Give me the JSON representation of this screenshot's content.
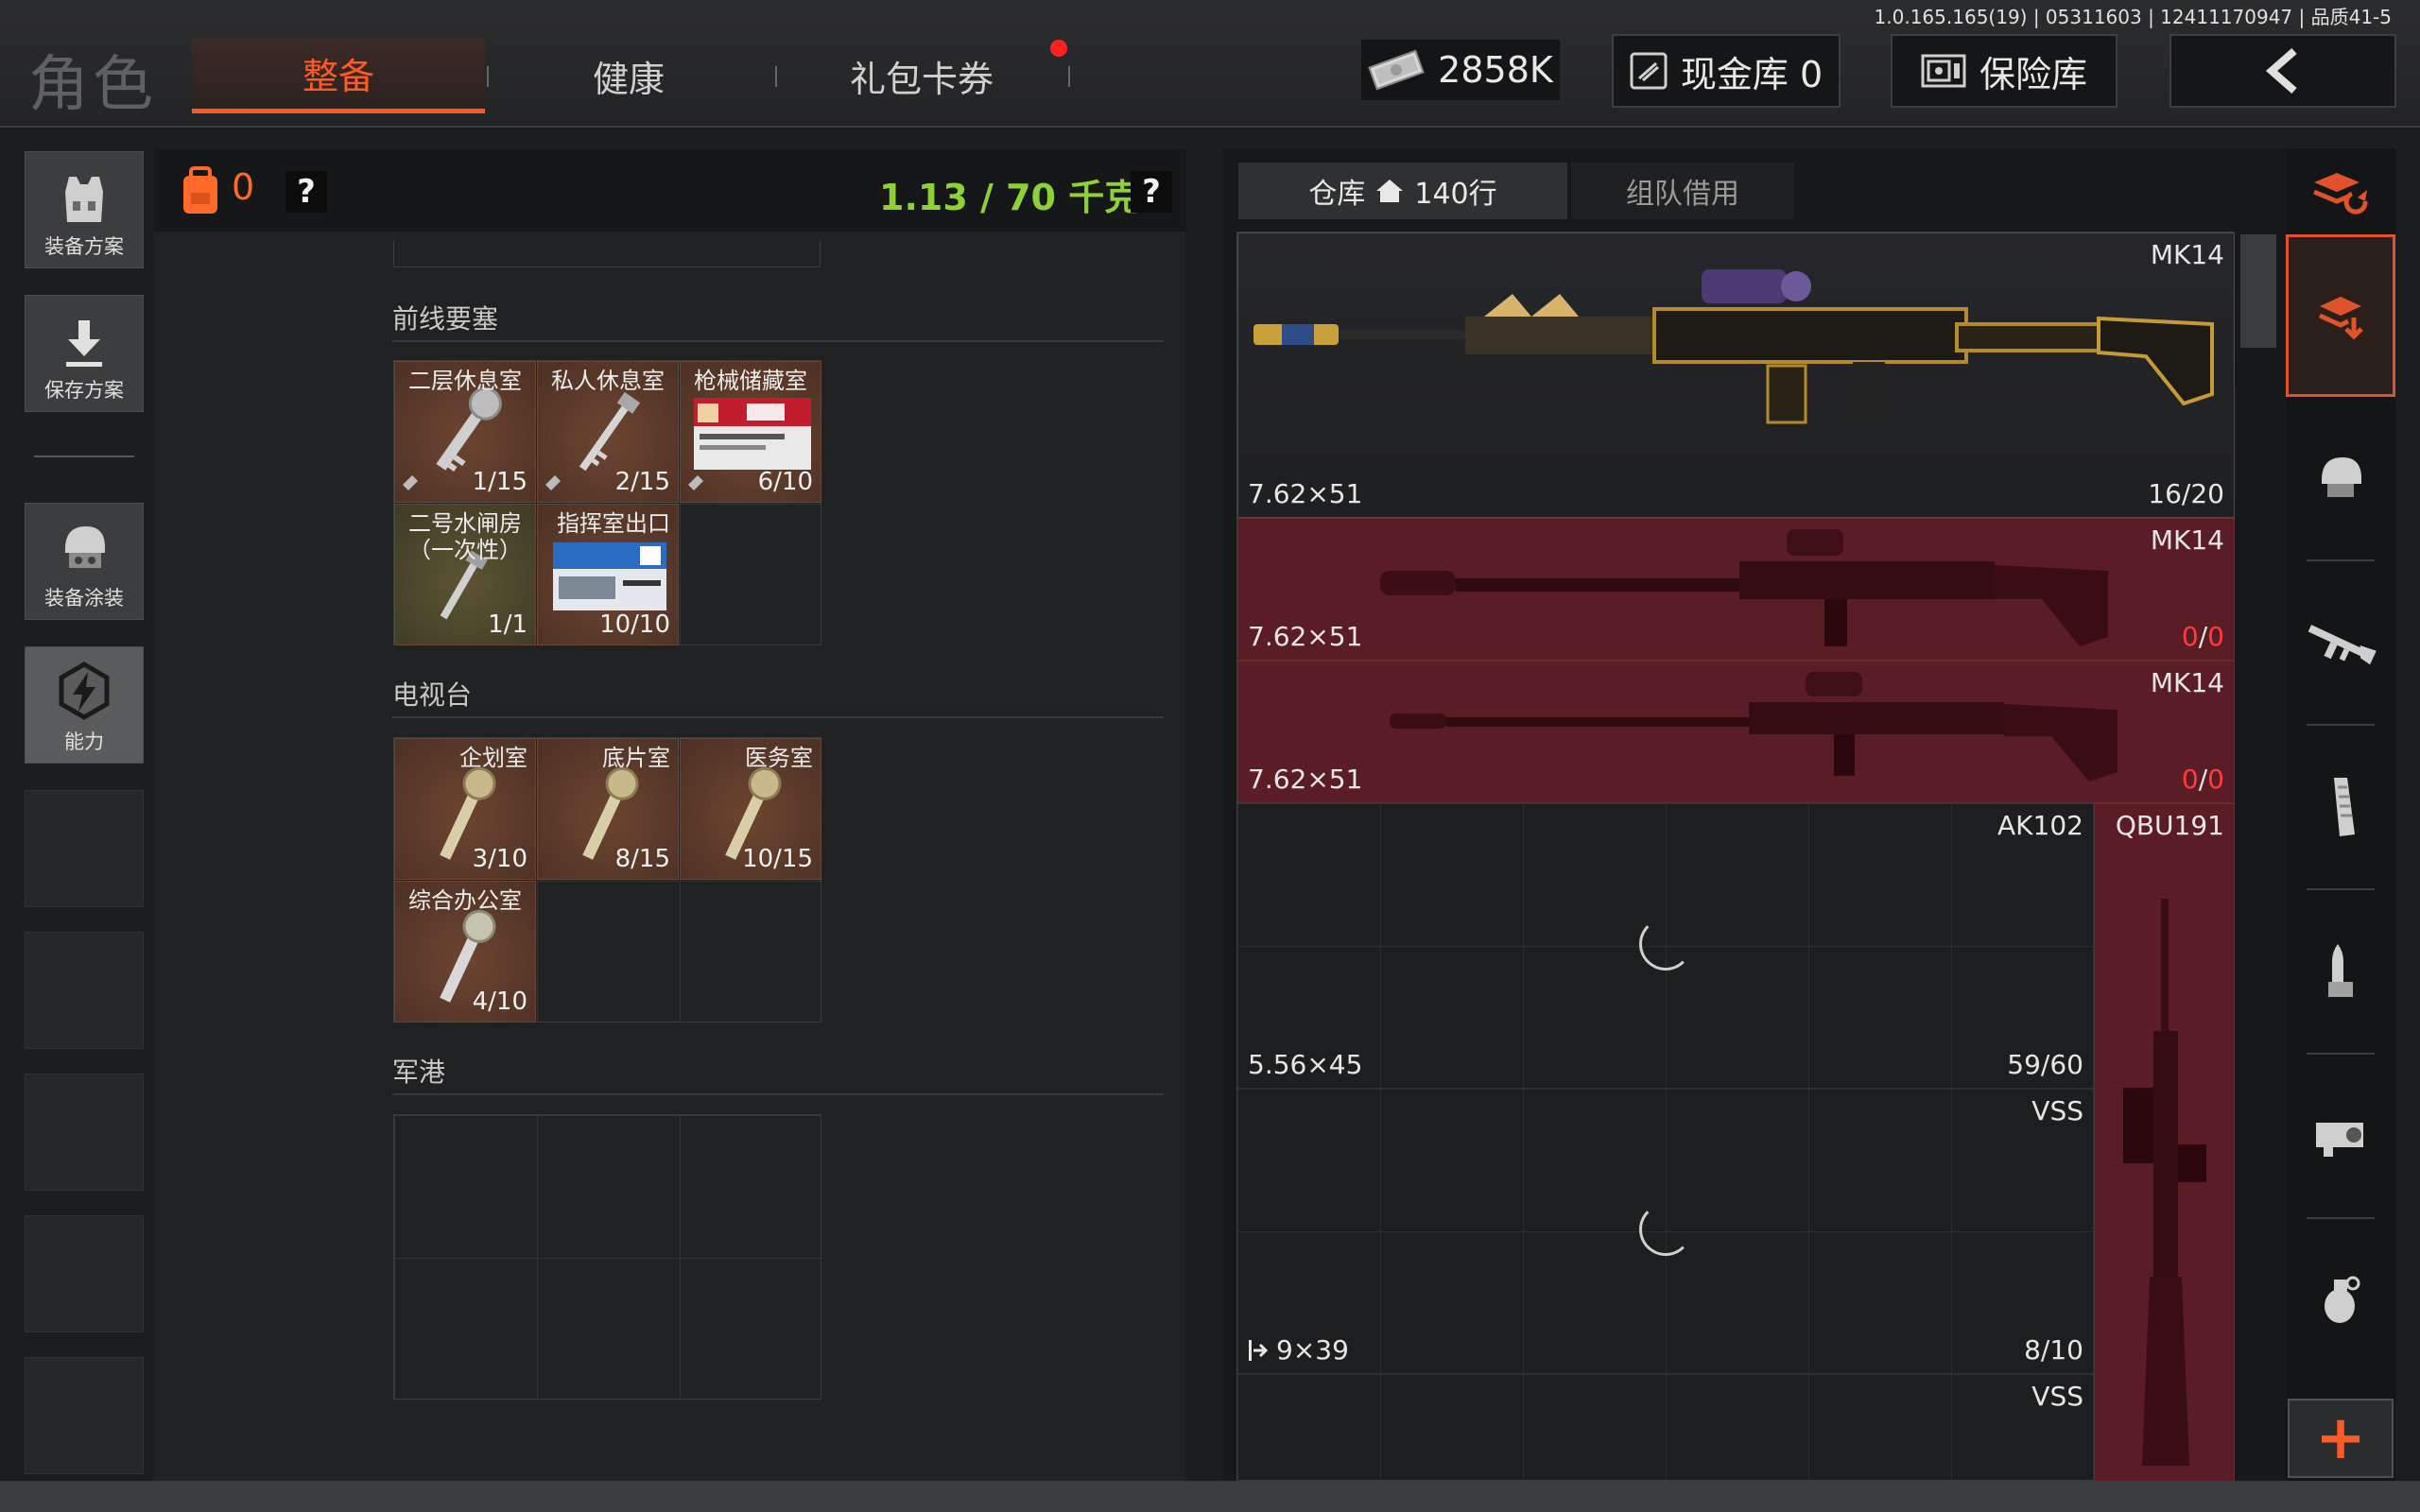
{
  "version": "1.0.165.165(19) | 05311603 | 12411170947 | 品质41-5",
  "page_title": "角色",
  "tabs": {
    "equip": "整备",
    "health": "健康",
    "gift": "礼包卡券"
  },
  "money": "2858K",
  "buttons": {
    "cash_vault": "现金库 0",
    "safe": "保险库"
  },
  "left_menu": {
    "plan": "装备方案",
    "save": "保存方案",
    "paint": "装备涂装",
    "ability": "能力"
  },
  "backpack": {
    "count": "0",
    "weight": "1.13 / 70 千克",
    "help": "?"
  },
  "sections": [
    {
      "title": "前线要塞",
      "slots": [
        {
          "name": "二层休息室",
          "count": "1/15"
        },
        {
          "name": "私人休息室",
          "count": "2/15"
        },
        {
          "name": "枪械储藏室",
          "count": "6/10"
        },
        {
          "name": "二号水闸房（一次性）",
          "count": "1/1"
        },
        {
          "name": "指挥室出口",
          "count": "10/10"
        }
      ]
    },
    {
      "title": "电视台",
      "slots": [
        {
          "name": "企划室",
          "count": "3/10"
        },
        {
          "name": "底片室",
          "count": "8/15"
        },
        {
          "name": "医务室",
          "count": "10/15"
        },
        {
          "name": "综合办公室",
          "count": "4/10"
        }
      ]
    },
    {
      "title": "军港",
      "slots": []
    }
  ],
  "warehouse": {
    "tab_label": "仓库",
    "rows": "140行",
    "team_tab": "组队借用",
    "items": [
      {
        "name": "MK14",
        "ammo": "7.62×51",
        "durability": "16/20"
      },
      {
        "name": "MK14",
        "ammo": "7.62×51",
        "durability_a": "0",
        "durability_b": "0"
      },
      {
        "name": "MK14",
        "ammo": "7.62×51",
        "durability_a": "0",
        "durability_b": "0"
      },
      {
        "name": "AK102",
        "ammo": "5.56×45",
        "durability": "59/60"
      },
      {
        "name": "QBU191"
      },
      {
        "name": "VSS",
        "ammo": "9×39",
        "durability": "8/10"
      },
      {
        "name": "VSS"
      }
    ]
  },
  "add_button": "+"
}
